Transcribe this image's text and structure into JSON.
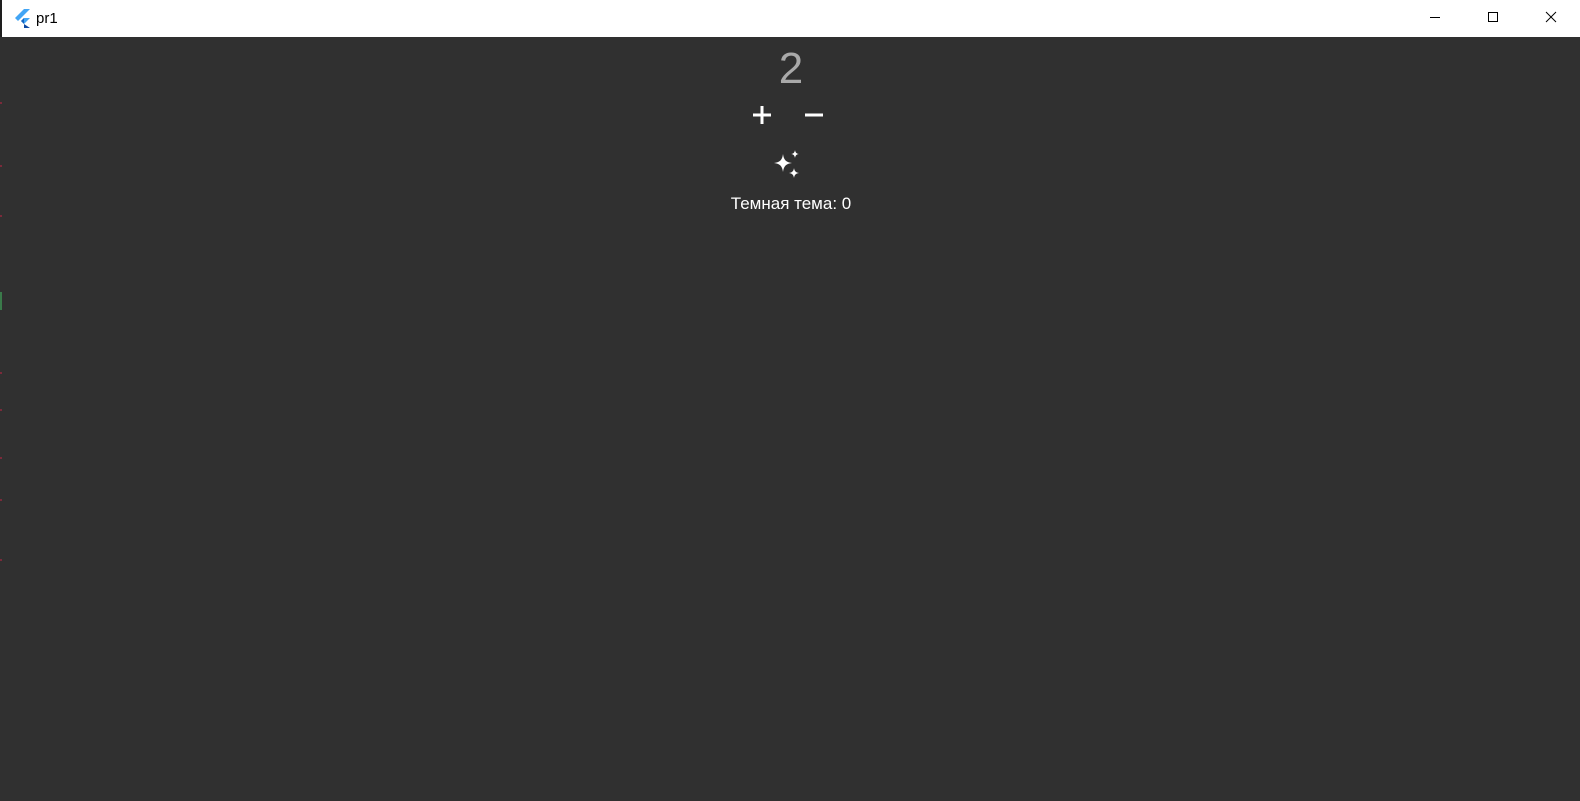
{
  "window": {
    "title": "pr1",
    "app_icon": "flutter-logo-icon",
    "controls": [
      "minimize-icon",
      "maximize-icon",
      "close-icon"
    ]
  },
  "main": {
    "counter_value": "2",
    "increment_icon": "plus-icon",
    "decrement_icon": "minus-icon",
    "theme_toggle_icon": "sparkles-icon",
    "theme_label": "Темная тема: 0"
  },
  "colors": {
    "background": "#303030",
    "titlebar": "#ffffff",
    "counter_text": "#a9a9a9",
    "label_text": "#ffffff",
    "flutter_blue": "#42a5f5",
    "flutter_dark_blue": "#0d47a1"
  }
}
